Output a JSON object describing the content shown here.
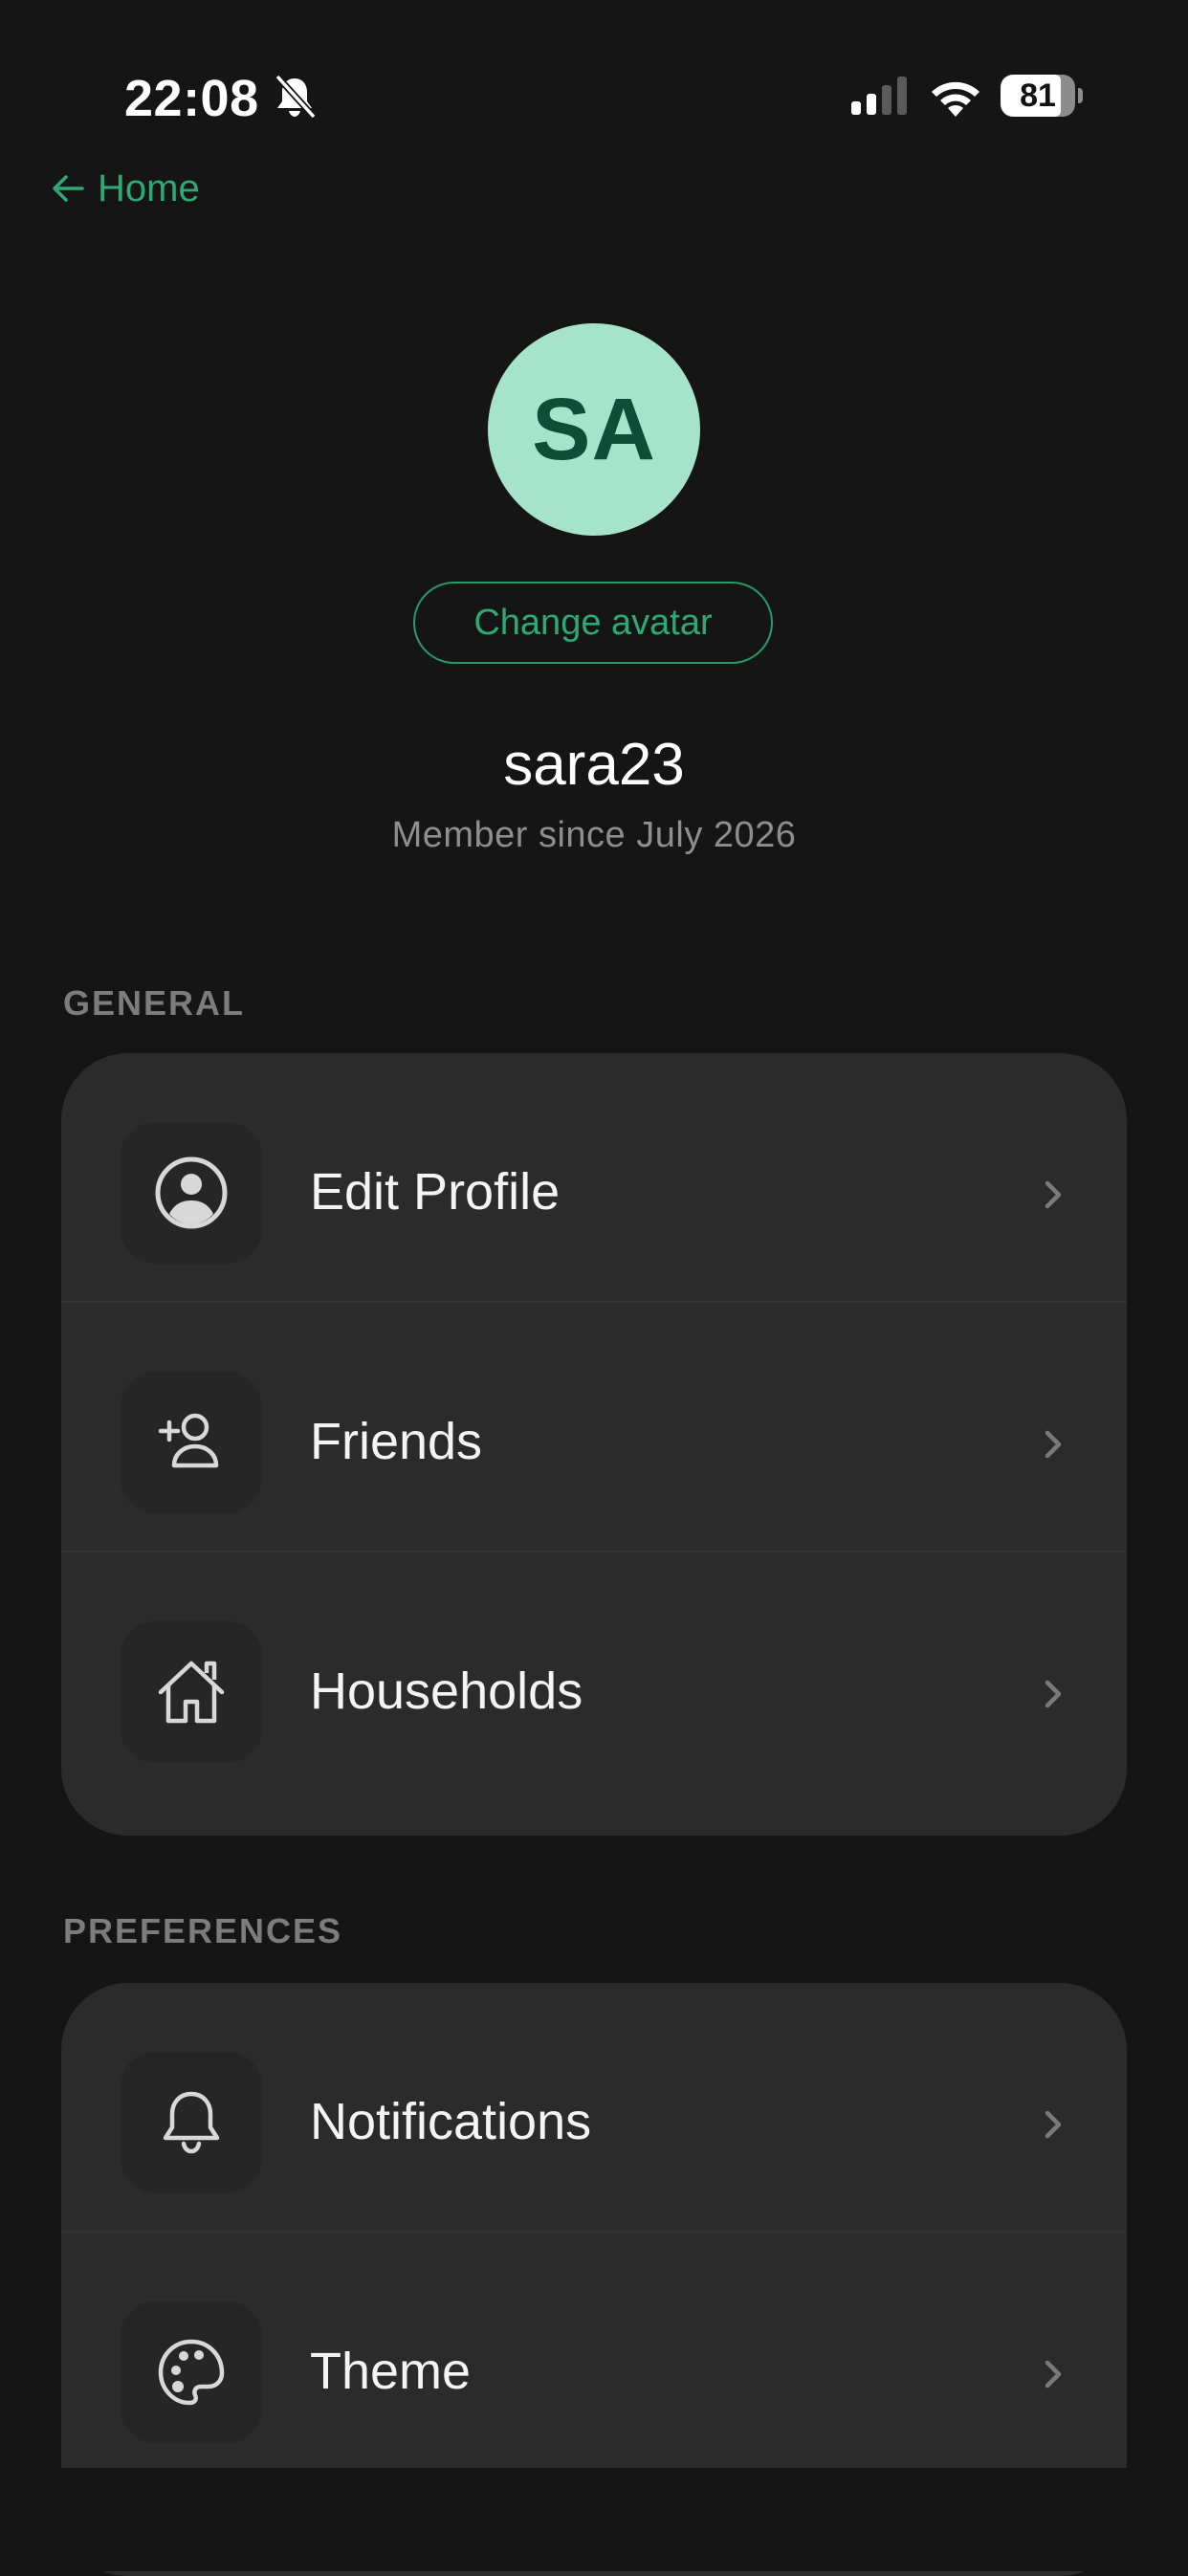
{
  "status_bar": {
    "time": "22:08",
    "battery_level": "81",
    "battery_fraction": 0.81,
    "icons": [
      "bell-off-icon",
      "cellular-signal-icon",
      "wifi-icon",
      "battery-icon"
    ]
  },
  "nav": {
    "back_label": "Home",
    "back_icon": "arrow-left-icon"
  },
  "profile": {
    "initials": "SA",
    "change_avatar_label": "Change avatar",
    "username": "sara23",
    "member_since": "Member since July 2026"
  },
  "colors": {
    "accent": "#2fa974",
    "avatar_bg": "#a6e3cb",
    "avatar_text": "#0f4d38",
    "background": "#151515",
    "card": "#2b2b2b"
  },
  "sections": [
    {
      "title": "GENERAL",
      "items": [
        {
          "label": "Edit Profile",
          "icon": "user-circle-icon"
        },
        {
          "label": "Friends",
          "icon": "add-friend-icon"
        },
        {
          "label": "Households",
          "icon": "house-icon"
        }
      ]
    },
    {
      "title": "PREFERENCES",
      "items": [
        {
          "label": "Notifications",
          "icon": "bell-icon"
        },
        {
          "label": "Theme",
          "icon": "palette-icon"
        }
      ]
    }
  ]
}
